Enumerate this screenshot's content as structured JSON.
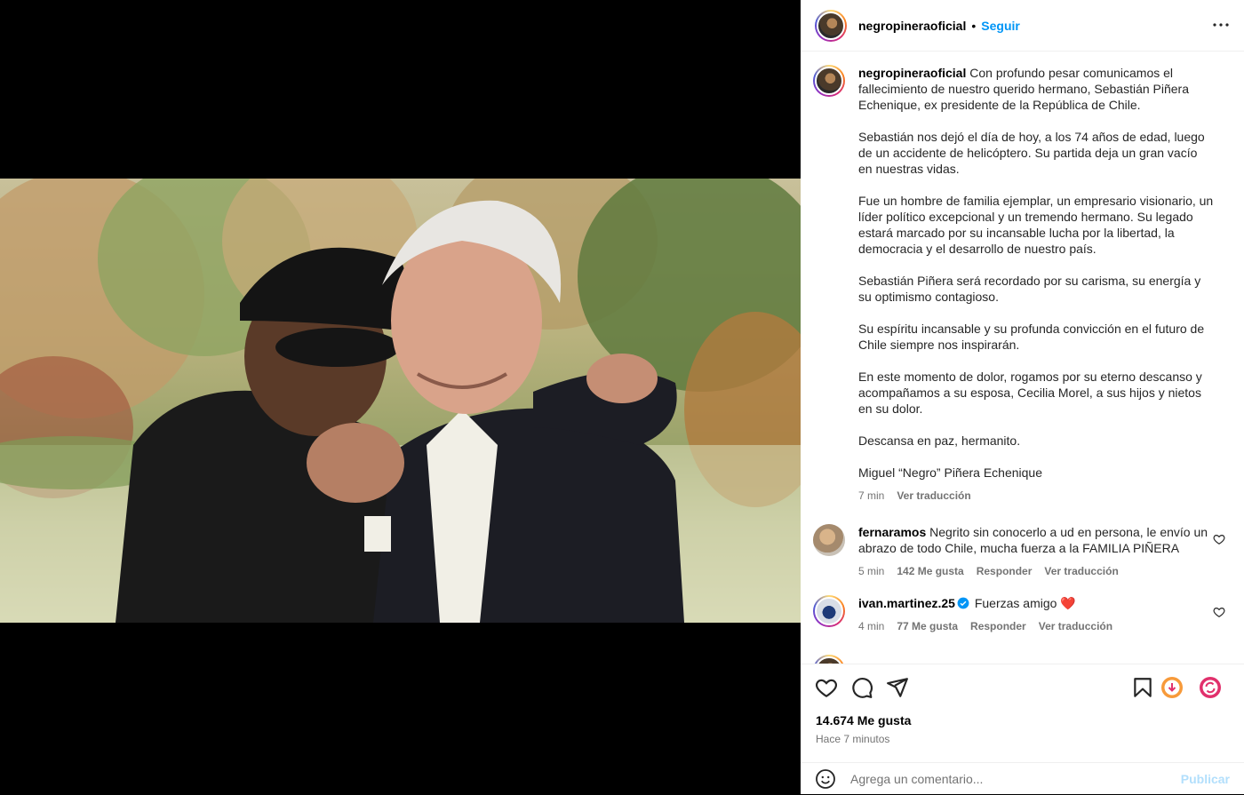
{
  "post": {
    "username": "negropineraoficial",
    "follow_label": "Seguir",
    "separator": "•",
    "more_icon": "more-horizontal-icon"
  },
  "caption": {
    "username": "negropineraoficial",
    "paragraphs": [
      "Con profundo pesar comunicamos el fallecimiento de nuestro querido hermano, Sebastián Piñera Echenique, ex presidente de la República de Chile.",
      "Sebastián nos dejó el día de hoy, a los 74 años de edad, luego de un accidente de helicóptero. Su partida deja un gran vacío en nuestras vidas.",
      "Fue un hombre de familia ejemplar, un empresario visionario, un líder político excepcional y un tremendo hermano. Su legado estará marcado por su incansable lucha por la libertad, la democracia y el desarrollo de nuestro país.",
      "Sebastián Piñera será recordado por su carisma, su energía y su optimismo contagioso.",
      "Su espíritu incansable y su profunda convicción en el futuro de Chile siempre nos inspirarán.",
      "En este momento de dolor, rogamos por su eterno descanso y acompañamos a su esposa, Cecilia Morel, a sus hijos y nietos en su dolor.",
      "Descansa en paz, hermanito.",
      "Miguel “Negro” Piñera Echenique"
    ],
    "time": "7 min",
    "translate": "Ver traducción"
  },
  "comments": [
    {
      "username": "fernaramos",
      "text": "Negrito sin conocerlo a ud en persona, le envío un abrazo de todo Chile, mucha fuerza a la FAMILIA PIÑERA",
      "time": "5 min",
      "likes": "142 Me gusta",
      "reply": "Responder",
      "translate": "Ver traducción"
    },
    {
      "username": "ivan.martinez.25",
      "text": "Fuerzas amigo",
      "emoji": "❤️",
      "time": "4 min",
      "likes": "77 Me gusta",
      "reply": "Responder",
      "translate": "Ver traducción"
    }
  ],
  "footer": {
    "likes": "14.674 Me gusta",
    "ago": "Hace 7 minutos",
    "comment_placeholder": "Agrega un comentario...",
    "publish": "Publicar"
  },
  "colors": {
    "accent": "#0095f6",
    "publish_disabled": "#b2dffc",
    "heart": "#ed4956"
  }
}
